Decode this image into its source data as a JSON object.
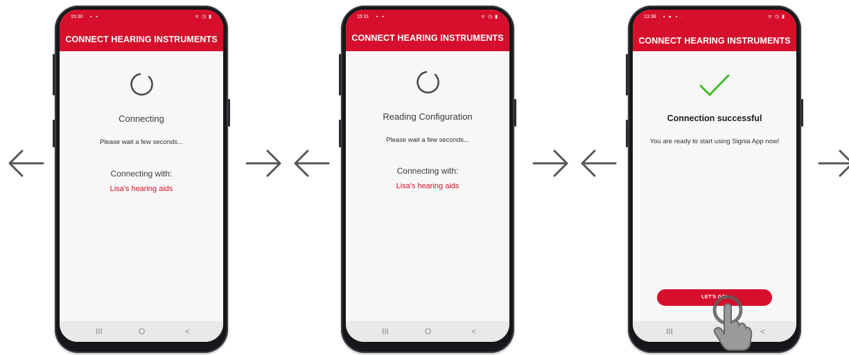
{
  "screens": [
    {
      "status_time": "15:30",
      "status_icons": "▪ ▪",
      "status_right": "ᯤ ◷ ▮",
      "title": "CONNECT HEARING INSTRUMENTS",
      "state_icon": "spinner-icon",
      "status": "Connecting",
      "hint": "Please wait a few seconds...",
      "with_label": "Connecting with:",
      "device": "Lisa's hearing aids",
      "nav": {
        "recents": "III",
        "home": "O",
        "back": "<"
      }
    },
    {
      "status_time": "15:31",
      "status_icons": "▪ ▪",
      "status_right": "ᯤ ◷ ▮",
      "title": "CONNECT HEARING INSTRUMENTS",
      "state_icon": "spinner-icon",
      "status": "Reading Configuration",
      "hint": "Please wait a few seconds...",
      "with_label": "Connecting with:",
      "device": "Lisa's hearing aids",
      "nav": {
        "recents": "III",
        "home": "O",
        "back": "<"
      }
    },
    {
      "status_time": "13:38",
      "status_icons": "▪ ▸ ▪ ·",
      "status_right": "ᯤ ◷ ▮",
      "title": "CONNECT HEARING INSTRUMENTS",
      "state_icon": "check-icon",
      "status": "Connection successful",
      "hint": "You are ready to start using Signia App now!",
      "button": "LET'S GO!",
      "nav": {
        "recents": "III",
        "home": "O",
        "back": "<"
      }
    }
  ],
  "colors": {
    "brand": "#d6102c",
    "success": "#3fba1f",
    "frame": "#16171a"
  },
  "arrows": [
    "arrow-left-icon",
    "arrow-right-icon",
    "arrow-left-icon",
    "arrow-right-icon",
    "arrow-left-icon",
    "arrow-right-icon"
  ]
}
